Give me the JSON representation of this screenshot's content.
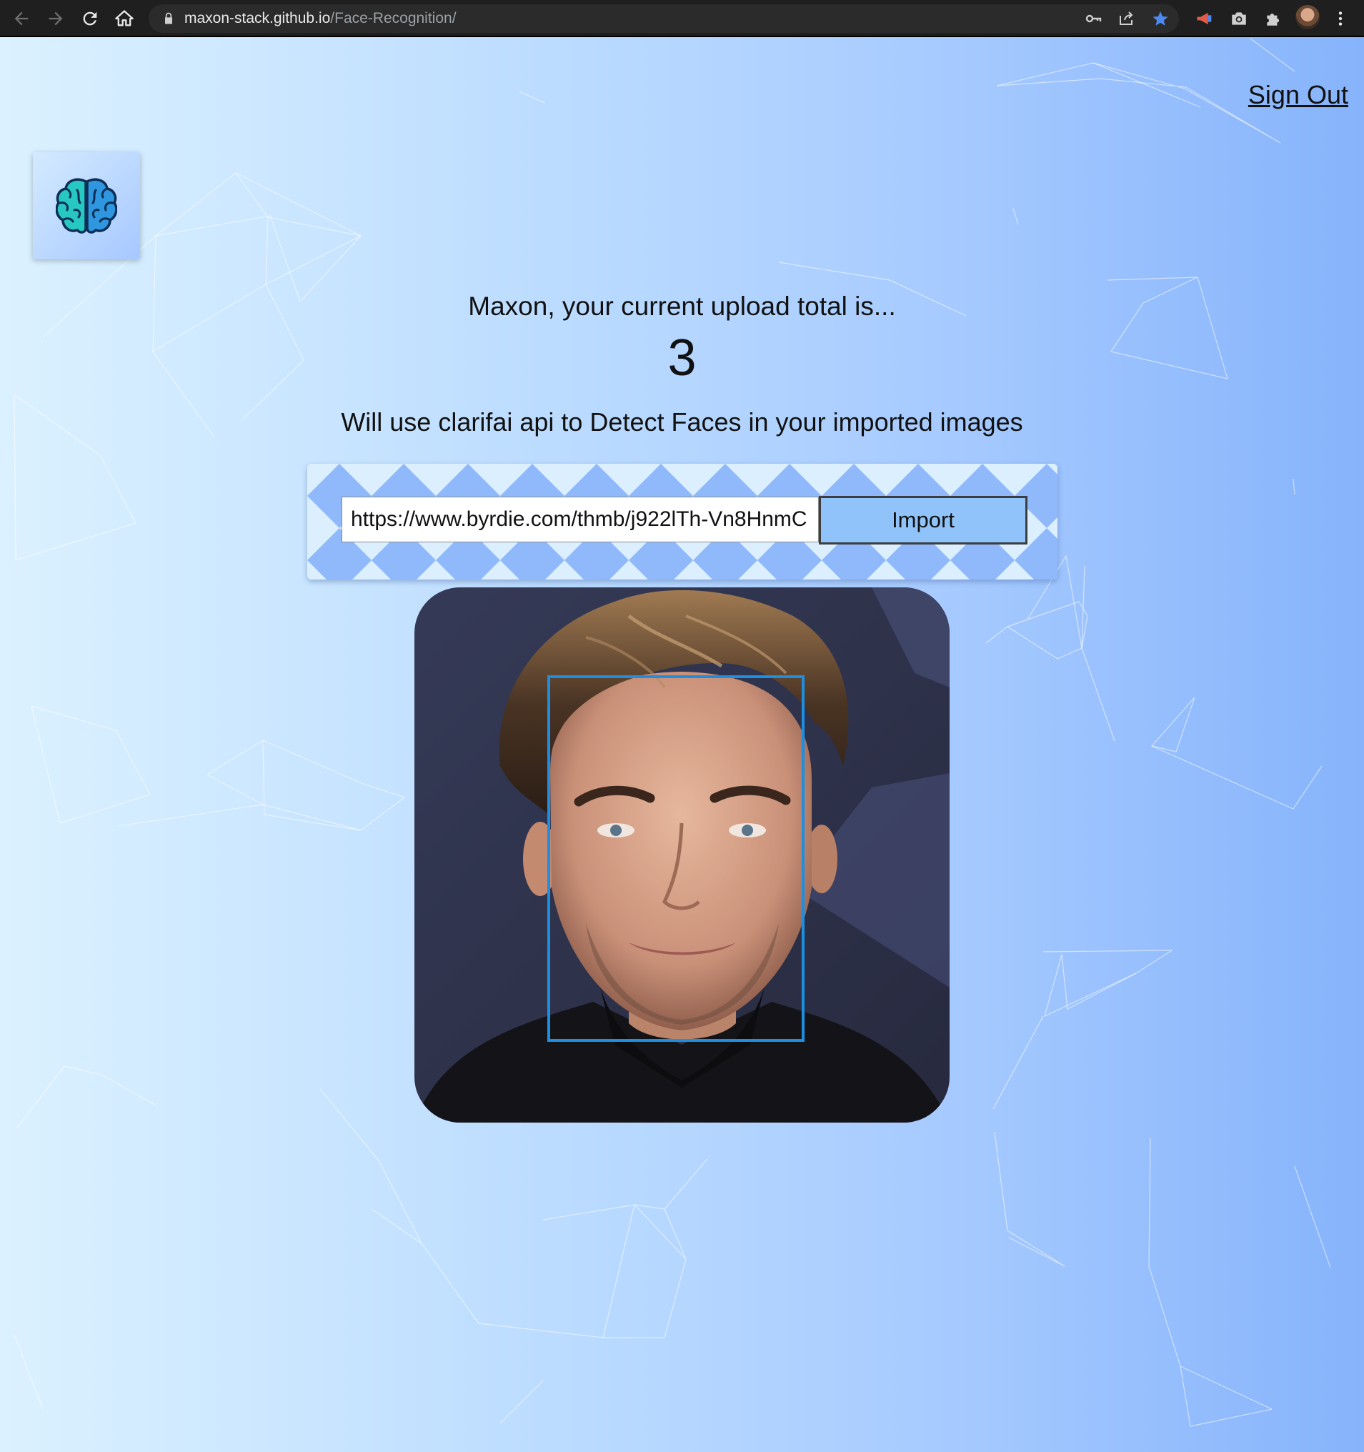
{
  "browser": {
    "url_host": "maxon-stack.github.io",
    "url_path": "/Face-Recognition/",
    "icons": [
      "back-icon",
      "forward-icon",
      "reload-icon",
      "home-icon",
      "lock-icon",
      "key-icon",
      "share-icon",
      "star-icon",
      "megaphone-icon",
      "camera-icon",
      "puzzle-icon",
      "avatar",
      "more-vert-icon"
    ]
  },
  "header": {
    "sign_out_label": "Sign Out",
    "logo_icon": "brain-icon"
  },
  "main": {
    "greeting": "Maxon, your current upload total is...",
    "upload_count": "3",
    "subtitle": "Will use clarifai api to Detect Faces in your imported images",
    "url_input_value": "https://www.byrdie.com/thmb/j922lTh-Vn8HnmC",
    "import_label": "Import",
    "face_box_color": "#1e8ee0"
  },
  "colors": {
    "background_left": "#dbf1ff",
    "background_right": "#86b3fb",
    "panel_light": "#dcefff",
    "panel_dark": "#8fb9fb",
    "import_button": "#8fc3fa"
  }
}
